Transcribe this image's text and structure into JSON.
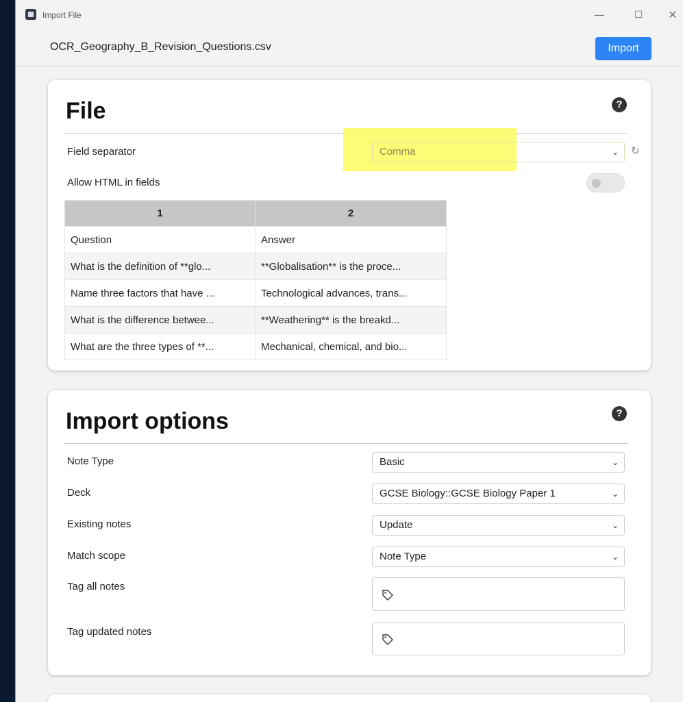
{
  "window": {
    "title": "Import File",
    "controls": [
      "—",
      "☐",
      "✕"
    ]
  },
  "header": {
    "filename": "OCR_Geography_B_Revision_Questions.csv",
    "import_label": "Import"
  },
  "file_section": {
    "title": "File",
    "help": "?",
    "field_separator": {
      "label": "Field separator",
      "value": "Comma"
    },
    "allow_html": {
      "label": "Allow HTML in fields",
      "checked": false
    },
    "table": {
      "columns": [
        "1",
        "2"
      ],
      "rows": [
        [
          "Question",
          "Answer"
        ],
        [
          "What is the definition of **glo...",
          "**Globalisation** is the proce..."
        ],
        [
          "Name three factors that have ...",
          "Technological advances, trans..."
        ],
        [
          "What is the difference betwee...",
          "**Weathering** is the breakd..."
        ],
        [
          "What are the three types of **...",
          "Mechanical, chemical, and bio..."
        ]
      ]
    }
  },
  "import_options": {
    "title": "Import options",
    "help": "?",
    "note_type": {
      "label": "Note Type",
      "value": "Basic"
    },
    "deck": {
      "label": "Deck",
      "value": "GCSE Biology::GCSE Biology Paper 1"
    },
    "existing_notes": {
      "label": "Existing notes",
      "value": "Update"
    },
    "match_scope": {
      "label": "Match scope",
      "value": "Note Type"
    },
    "tag_all": {
      "label": "Tag all notes"
    },
    "tag_updated": {
      "label": "Tag updated notes"
    }
  },
  "colors": {
    "accent": "#2c84f5",
    "highlight": "#fbfb5e"
  }
}
